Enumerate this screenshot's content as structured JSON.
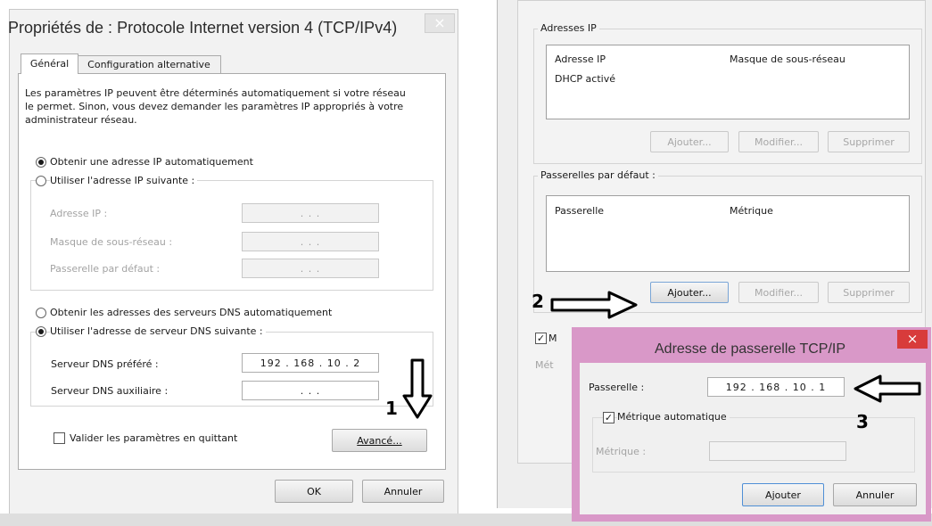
{
  "left": {
    "title": "Propriétés de : Protocole Internet version 4 (TCP/IPv4)",
    "tabs": [
      "Général",
      "Configuration alternative"
    ],
    "description": "Les paramètres IP peuvent être déterminés automatiquement si votre réseau le permet. Sinon, vous devez demander les paramètres IP appropriés à votre administrateur réseau.",
    "radio_auto_ip": "Obtenir une adresse IP automatiquement",
    "radio_manual_ip": "Utiliser l'adresse IP suivante :",
    "field_ip_label": "Adresse IP :",
    "field_mask_label": "Masque de sous-réseau :",
    "field_gw_label": "Passerelle par défaut :",
    "empty_ip": ".      .      .",
    "radio_auto_dns": "Obtenir les adresses des serveurs DNS automatiquement",
    "radio_manual_dns": "Utiliser l'adresse de serveur DNS suivante :",
    "dns_pref_label": "Serveur DNS préféré :",
    "dns_pref_value": "192 . 168 . 10 . 2",
    "dns_aux_label": "Serveur DNS auxiliaire :",
    "dns_aux_value": ".      .      .",
    "validate_label": "Valider les paramètres en quittant",
    "advanced_button": "Avancé...",
    "ok_button": "OK",
    "cancel_button": "Annuler"
  },
  "right": {
    "ip_group_label": "Adresses IP",
    "ip_col_address": "Adresse IP",
    "ip_col_mask": "Masque de sous-réseau",
    "ip_row": "DHCP activé",
    "add_button": "Ajouter...",
    "modify_button": "Modifier...",
    "delete_button": "Supprimer",
    "gw_group_label": "Passerelles par défaut :",
    "gw_col_gateway": "Passerelle",
    "gw_col_metric": "Métrique",
    "partial_check_label": "M",
    "partial_metric_label": "Mét"
  },
  "dialog": {
    "title": "Adresse de passerelle TCP/IP",
    "gateway_label": "Passerelle :",
    "gateway_value": "192 . 168 . 10 . 1",
    "auto_metric_label": "Métrique automatique",
    "metric_label": "Métrique :",
    "add_button": "Ajouter",
    "cancel_button": "Annuler",
    "close_glyph": "×"
  },
  "annotations": {
    "step1": "1",
    "step2": "2",
    "step3": "3"
  },
  "colors": {
    "dialog_frame": "#d998c8",
    "close_button": "#d83b3b"
  }
}
